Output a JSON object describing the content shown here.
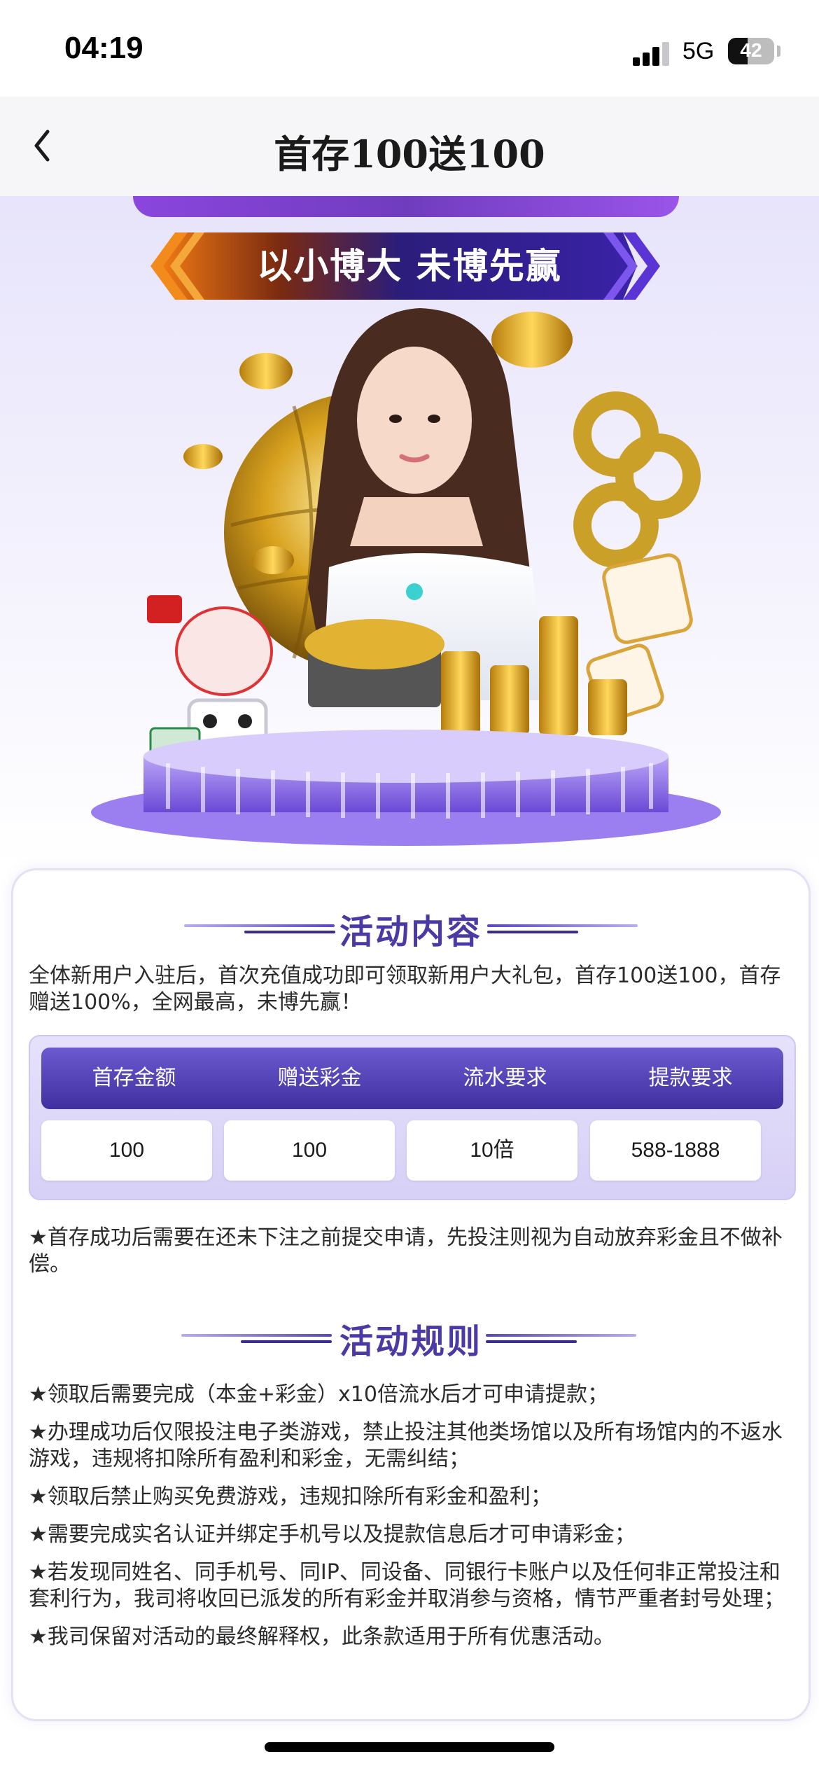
{
  "status_bar": {
    "time": "04:19",
    "network": "5G",
    "battery_level": "42"
  },
  "nav": {
    "title": "首存100送100"
  },
  "hero": {
    "banner_text": "以小博大 未博先赢"
  },
  "section1": {
    "title": "活动内容",
    "intro": "全体新用户入驻后，首次充值成功即可领取新用户大礼包，首存100送100，首存赠送100%，全网最高，未博先赢！",
    "table": {
      "headers": [
        "首存金额",
        "赠送彩金",
        "流水要求",
        "提款要求"
      ],
      "row": [
        "100",
        "100",
        "10倍",
        "588-1888"
      ]
    },
    "note": "★首存成功后需要在还未下注之前提交申请，先投注则视为自动放弃彩金且不做补偿。"
  },
  "section2": {
    "title": "活动规则",
    "rules": [
      "★领取后需要完成（本金+彩金）x10倍流水后才可申请提款；",
      "★办理成功后仅限投注电子类游戏，禁止投注其他类场馆以及所有场馆内的不返水游戏，违规将扣除所有盈利和彩金，无需纠结；",
      "★领取后禁止购买免费游戏，违规扣除所有彩金和盈利；",
      "★需要完成实名认证并绑定手机号以及提款信息后才可申请彩金；",
      "★若发现同姓名、同手机号、同IP、同设备、同银行卡账户以及任何非正常投注和套利行为，我司将收回已派发的所有彩金并取消参与资格，情节严重者封号处理；",
      "★我司保留对活动的最终解释权，此条款适用于所有优惠活动。"
    ]
  },
  "colors": {
    "accent": "#4b3aa6",
    "header_bg": "#3f2f9f",
    "gold": "#e8b52a"
  }
}
